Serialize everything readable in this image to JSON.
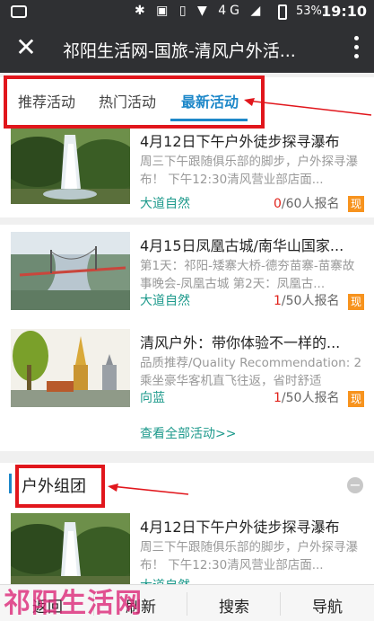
{
  "status": {
    "network": "4G",
    "battery": "53%",
    "time": "19:10"
  },
  "header": {
    "title": "祁阳生活网-国旅-清风户外活..."
  },
  "tabs": [
    {
      "label": "推荐活动"
    },
    {
      "label": "热门活动"
    },
    {
      "label": "最新活动"
    }
  ],
  "activities": [
    {
      "title": "4月12日下午户外徒步探寻瀑布",
      "desc": "周三下午跟随俱乐部的脚步，户外探寻瀑布！ 下午12:30清风营业部店面...",
      "tag": "大道自然",
      "joined": "0",
      "capacity": "/60人报名",
      "badge": "现"
    },
    {
      "title": "4月15日凤凰古城/南华山国家...",
      "desc": "第1天：祁阳-矮寨大桥-德夯苗寨-苗寨故事晚会-凤凰古城 第2天：凤凰古...",
      "tag": "大道自然",
      "joined": "1",
      "capacity": "/50人报名",
      "badge": "现"
    },
    {
      "title": "清风户外：带你体验不一样的...",
      "desc": "品质推荐/Quality Recommendation: 2乘坐豪华客机直飞往返，省时舒适",
      "tag": "向蓝",
      "joined": "1",
      "capacity": "/50人报名",
      "badge": "现"
    }
  ],
  "view_all": "查看全部活动>>",
  "section": {
    "title": "户外组团",
    "collapse": "−"
  },
  "group_items": [
    {
      "title": "4月12日下午户外徒步探寻瀑布",
      "desc": "周三下午跟随俱乐部的脚步，户外探寻瀑布！ 下午12:30清风营业部店面...",
      "tag": "大道自然"
    }
  ],
  "bottom_nav": {
    "back": "返回",
    "refresh": "刷新",
    "search": "搜索",
    "nav": "导航"
  },
  "watermark": "祁阳生活网",
  "colors": {
    "accent": "#1e88c9",
    "highlight": "#e1161c",
    "tag": "#1e9a8c",
    "badge": "#f7931e"
  }
}
